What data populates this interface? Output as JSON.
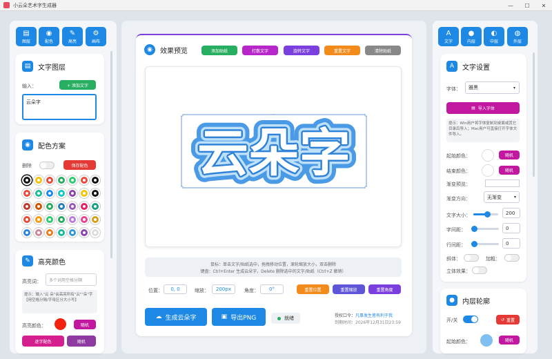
{
  "window": {
    "title": "小云朵艺术字生成器",
    "min": "—",
    "max": "☐",
    "close": "✕"
  },
  "left": {
    "tabs": [
      {
        "label": "图层",
        "icon": "▤"
      },
      {
        "label": "配色",
        "icon": "◉"
      },
      {
        "label": "高亮",
        "icon": "✎"
      },
      {
        "label": "画布",
        "icon": "⚙"
      }
    ],
    "layer": {
      "title": "文字图层",
      "input_label": "输入：",
      "add_button": "+ 添加文字",
      "text_value": "云朵字"
    },
    "palette": {
      "title": "配色方案",
      "delete_label": "删除",
      "save_button": "保存配色",
      "swatches": [
        "#111111",
        "#f1c40f",
        "#e74c3c",
        "#27ae60",
        "#2ecc71",
        "#e74c3c",
        "#111111",
        "#e74c3c",
        "#1abc9c",
        "#1e88e5",
        "#1ac6c6",
        "#8e44ad",
        "#f1c40f",
        "#111111",
        "#c0392b",
        "#d35400",
        "#27ae60",
        "#2980b9",
        "#9b59b6",
        "#e91e63",
        "#16a085",
        "#e74c3c",
        "#f39c12",
        "#2ecc71",
        "#27ae60",
        "#c07ad7",
        "#e84393",
        "#d4a017",
        "#2e86de",
        "#cc8899",
        "#e67e22",
        "#1abc9c",
        "#3498db",
        "#8e44ad",
        "#dddddd"
      ]
    },
    "highlight": {
      "title": "高亮颜色",
      "word_label": "高亮词：",
      "word_placeholder": "多个词用空格分隔",
      "tip": "提示：输入\"云 朵\"会高亮所有\"云\"\"朵\"字【用空格分隔/字母区分大小写】",
      "color_label": "高亮颜色：",
      "random_button": "随机",
      "char_color_button": "逐字配色",
      "random2_button": "随机"
    }
  },
  "center": {
    "preview_title": "效果预览",
    "toolbar": [
      {
        "label": "添加贴纸",
        "color": "#27ae60"
      },
      {
        "label": "打散文字",
        "color": "#b726c9"
      },
      {
        "label": "旋转文字",
        "color": "#7b3fe0"
      },
      {
        "label": "重置文字",
        "color": "#f28a1c"
      },
      {
        "label": "清除贴纸",
        "color": "#888888"
      }
    ],
    "canvas_text": "云朵字",
    "hint1": "鼠标：单击文字/贴纸选中，拖拽移动位置，滚轮缩放大小，双击删除",
    "hint2": "键盘：Ctrl+Enter 生成云朵字，Delete 删除选中的文字/贴纸（Ctrl+Z 撤销）",
    "position_label": "位置：",
    "position_value": "0, 0",
    "scale_label": "缩放：",
    "scale_value": "200px",
    "angle_label": "角度：",
    "angle_value": "0°",
    "reset_pos": "重置位置",
    "reset_scale": "重置缩放",
    "reset_angle": "重置角度",
    "generate_button": "生成云朵字",
    "export_button": "导出PNG",
    "status": "就绪",
    "license_label": "授权口令：",
    "license_value": "凡事发生皆有利于我",
    "expire": "到期时间：2026年12月31日23:59"
  },
  "right": {
    "tabs": [
      {
        "label": "文字",
        "icon": "A"
      },
      {
        "label": "内层",
        "icon": "●"
      },
      {
        "label": "中层",
        "icon": "◐"
      },
      {
        "label": "外层",
        "icon": "◍"
      }
    ],
    "text_settings": {
      "title": "文字设置",
      "font_label": "字体：",
      "font_value": "雅黑",
      "import_font": "导入字体",
      "tip": "提示：Win用户将字体复制到桌面或其它目录后导入；Mac用户可直接打开字体文件导入。",
      "start_color": "起始颜色：",
      "end_color": "结束颜色：",
      "random": "随机",
      "gradient_preview": "渐变预览：",
      "gradient_dir": "渐变方向：",
      "gradient_value": "无渐变",
      "size_label": "文字大小：",
      "size_value": "200",
      "spacing_label": "字间距：",
      "spacing_value": "0",
      "line_label": "行间距：",
      "line_value": "0",
      "italic": "斜体：",
      "bold": "加粗：",
      "three_d": "立体效果："
    },
    "inner": {
      "title": "内层轮廓",
      "switch_label": "开/关",
      "reset": "重置",
      "start_color": "起始颜色：",
      "random": "随机"
    }
  }
}
